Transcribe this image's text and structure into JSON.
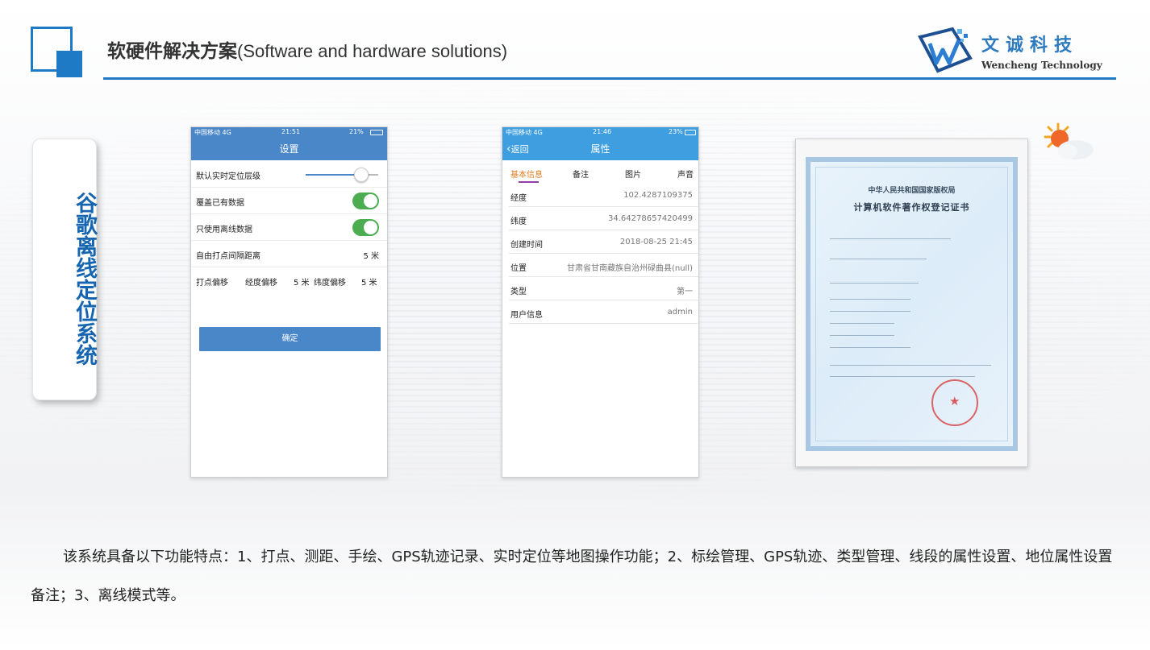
{
  "header": {
    "title_cn": "软硬件解决方案",
    "title_en": "(Software and hardware solutions)",
    "brand_cn": "文诚科技",
    "brand_en": "Wencheng Technology"
  },
  "side_label": "谷歌离线定位系统",
  "phone_settings": {
    "status": {
      "carrier": "中国移动  4G",
      "time": "21:51",
      "battery": "21%"
    },
    "title": "设置",
    "rows": [
      {
        "label": "默认实时定位层级",
        "control": "slider",
        "value": 0.75
      },
      {
        "label": "覆盖已有数据",
        "control": "toggle",
        "on": true
      },
      {
        "label": "只使用离线数据",
        "control": "toggle",
        "on": true
      },
      {
        "label": "自由打点间隔距离",
        "value": "5 米"
      }
    ],
    "offset": {
      "label": "打点偏移",
      "lon_label": "经度偏移",
      "lon_value": "5 米",
      "lat_label": "纬度偏移",
      "lat_value": "5 米"
    },
    "confirm_button": "确定"
  },
  "phone_properties": {
    "status": {
      "carrier": "中国移动  4G",
      "time": "21:46",
      "battery": "23%"
    },
    "back": "返回",
    "title": "属性",
    "tabs": [
      "基本信息",
      "备注",
      "图片",
      "声音"
    ],
    "active_tab": 0,
    "rows": [
      {
        "key": "经度",
        "value": "102.4287109375"
      },
      {
        "key": "纬度",
        "value": "34.64278657420499"
      },
      {
        "key": "创建时间",
        "value": "2018-08-25 21:45"
      },
      {
        "key": "位置",
        "value": "甘肃省甘南藏族自治州碌曲县(null)"
      },
      {
        "key": "类型",
        "value": "第一"
      },
      {
        "key": "用户信息",
        "value": "admin"
      }
    ]
  },
  "certificate": {
    "heading": "中华人民共和国国家版权局",
    "title": "计算机软件著作权登记证书"
  },
  "description": "该系统具备以下功能特点：1、打点、测距、手绘、GPS轨迹记录、实时定位等地图操作功能；2、标绘管理、GPS轨迹、类型管理、线段的属性设置、地位属性设置备注；3、离线模式等。",
  "colors": {
    "accent": "#1e7ac4",
    "settings_bar": "#4a87c9",
    "properties_bar": "#3e9ee0",
    "active_tab": "#e07b1c",
    "toggle_on": "#4cad50"
  }
}
